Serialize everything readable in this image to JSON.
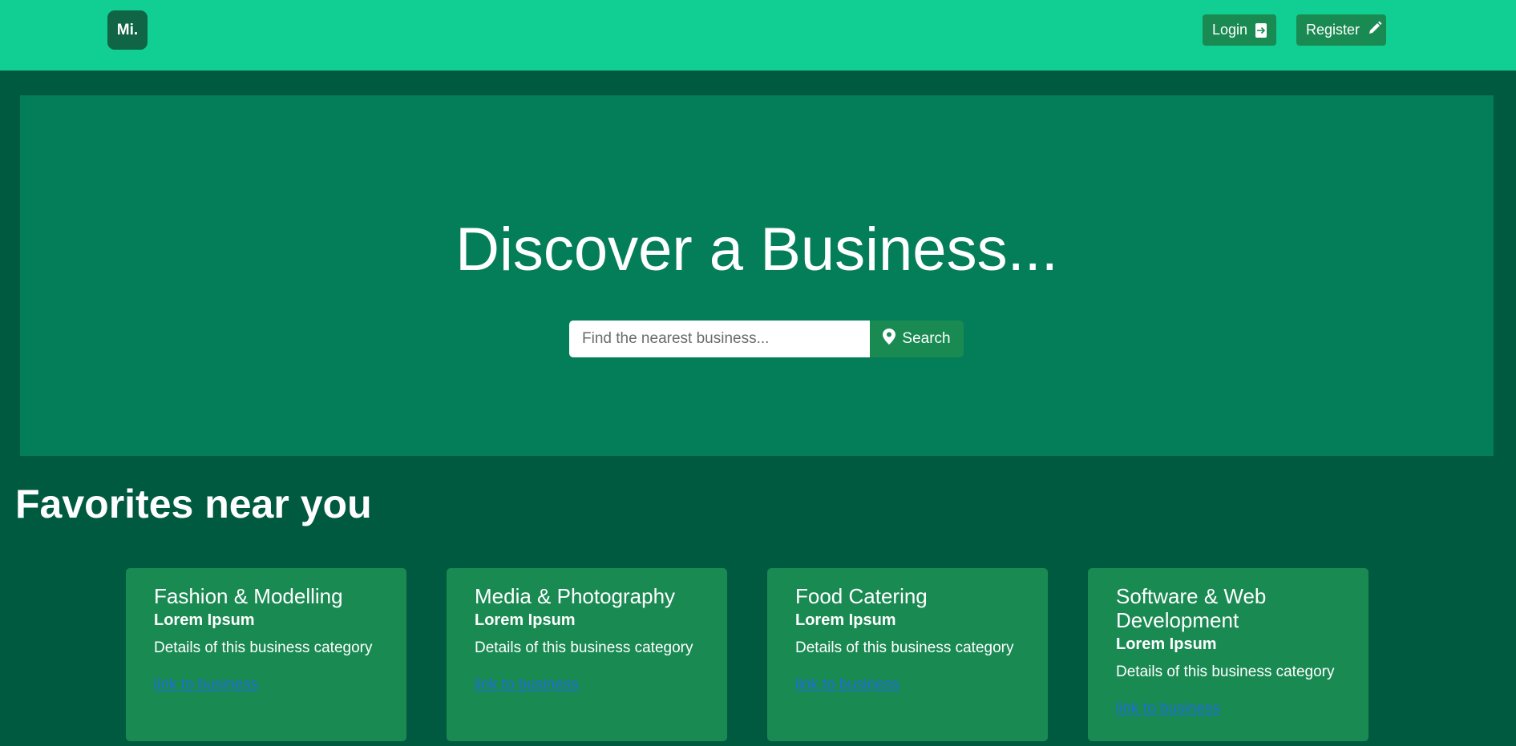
{
  "header": {
    "logo_text": "Mi.",
    "login_label": "Login",
    "register_label": "Register"
  },
  "hero": {
    "title": "Discover a Business...",
    "search_placeholder": "Find the nearest business...",
    "search_label": "Search"
  },
  "favorites": {
    "title": "Favorites near you",
    "cards": [
      {
        "title": "Fashion & Modelling",
        "subtitle": "Lorem Ipsum",
        "text": "Details of this business category",
        "link": "link to business"
      },
      {
        "title": "Media & Photography",
        "subtitle": "Lorem Ipsum",
        "text": "Details of this business category",
        "link": "link to business"
      },
      {
        "title": "Food Catering",
        "subtitle": "Lorem Ipsum",
        "text": "Details of this business category",
        "link": "link to business"
      },
      {
        "title": "Software & Web Development",
        "subtitle": "Lorem Ipsum",
        "text": "Details of this business category",
        "link": "link to business"
      }
    ]
  },
  "icons": {
    "login": "login-icon",
    "register": "pencil-icon",
    "search": "map-pin-icon"
  },
  "colors": {
    "navbar": "#11cf92",
    "background": "#005a40",
    "hero": "#047e59",
    "card": "#1a8a53",
    "link": "#1e6fd8"
  }
}
